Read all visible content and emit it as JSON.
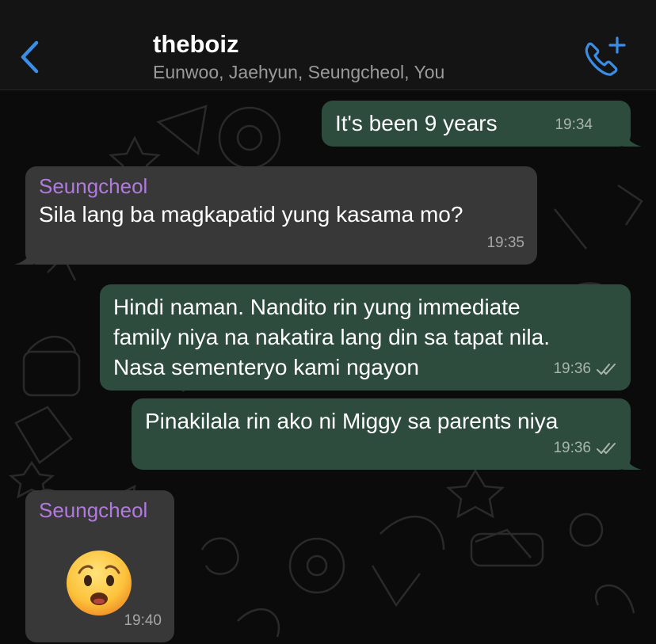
{
  "header": {
    "title": "theboiz",
    "members": "Eunwoo, Jaehyun, Seungcheol, You"
  },
  "messages": [
    {
      "direction": "out",
      "text": "It's been 9 years",
      "time": "19:34",
      "status": "sent"
    },
    {
      "direction": "in",
      "sender": "Seungcheol",
      "text": "Sila lang ba magkapatid yung kasama mo?",
      "time": "19:35"
    },
    {
      "direction": "out",
      "lines": [
        "Hindi naman. Nandito rin yung immediate",
        "family niya na nakatira lang din sa tapat nila.",
        "Nasa sementeryo kami ngayon"
      ],
      "time": "19:36",
      "status": "read"
    },
    {
      "direction": "out",
      "text": "Pinakilala rin ako ni Miggy sa parents niya",
      "time": "19:36",
      "status": "read"
    },
    {
      "direction": "in",
      "sender": "Seungcheol",
      "emoji": "anxious-face",
      "time": "19:40"
    }
  ],
  "colors": {
    "outgoing_bubble": "#2d4c3d",
    "incoming_bubble": "#383838",
    "sender_name": "#b27ae0",
    "accent": "#3a8ee6"
  },
  "icons": {
    "back": "chevron-left-icon",
    "call": "add-call-icon",
    "read_receipt": "double-check-icon"
  }
}
